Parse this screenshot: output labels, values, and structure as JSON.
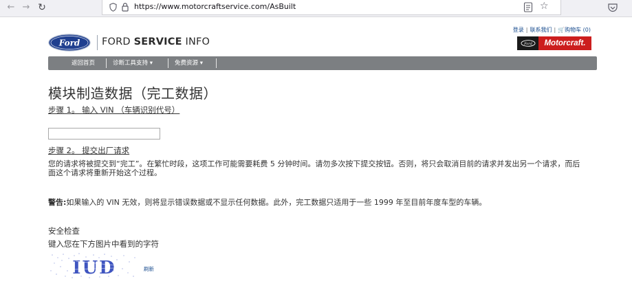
{
  "browser": {
    "url": "https://www.motorcraftservice.com/AsBuilt"
  },
  "header": {
    "brand_plain": "FORD ",
    "brand_bold": "SERVICE",
    "brand_tail": " INFO",
    "top_links": [
      "登录",
      "联系我们",
      "购物车 (0)"
    ],
    "motorcraft_label": "Motorcraft."
  },
  "nav": {
    "items": [
      "返回首页",
      "诊断工具支持 ▾",
      "免费资源 ▾"
    ]
  },
  "main": {
    "title": "模块制造数据（完工数据）",
    "step1": "步骤 1。 输入 VIN （车辆识别代号）",
    "vin_value": "",
    "step2": "步骤 2。 提交出厂请求",
    "request_text": "您的请求将被提交到“完工”。在繁忙时段，这项工作可能需要耗费 5 分钟时间。请勿多次按下提交按钮。否则，将只会取消目前的请求并发出另一个请求，而后面这个请求将重新开始这个过程。",
    "warning_label": "警告:",
    "warning_text": "如果输入的 VIN 无效，则将显示错误数据或不显示任何数据。此外，完工数据只适用于一些 1999 年至目前年度车型的车辆。",
    "security_title": "安全检查",
    "security_prompt": "键入您在下方图片中看到的字符",
    "captcha_text": "IUD",
    "refresh_label": "刷新"
  },
  "colors": {
    "link": "#1a4d8f",
    "navbar": "#7c7f82",
    "motorcraft_red": "#cc1e1e",
    "ford_blue": "#1f3f8f"
  }
}
